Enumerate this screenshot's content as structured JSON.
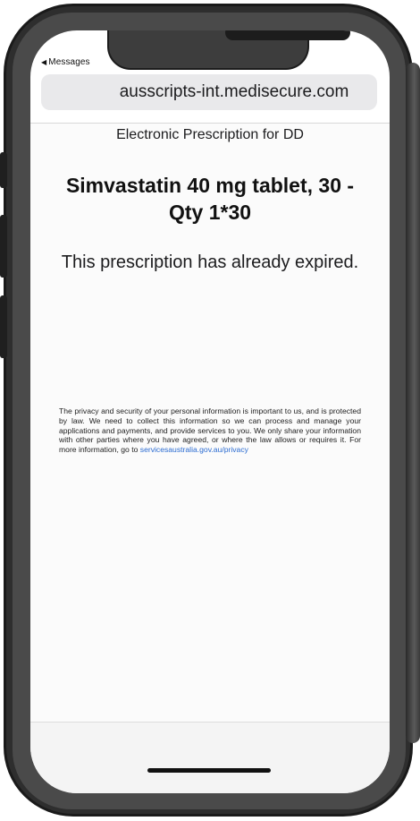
{
  "status_bar": {
    "back_label": "Messages"
  },
  "browser": {
    "url": "ausscripts-int.medisecure.com"
  },
  "page": {
    "subtitle": "Electronic Prescription for DD",
    "drug_title": "Simvastatin 40 mg tablet, 30 - Qty 1*30",
    "expired_message": "This prescription has already expired.",
    "privacy_text": "The privacy and security of your personal information is important to us, and is protected by law. We need to collect this information so we can process and manage your applications and payments, and provide services to you. We only share your information with other parties where you have agreed, or where the law allows or requires it. For more information, go to ",
    "privacy_link": "servicesaustralia.gov.au/privacy"
  },
  "colors": {
    "link": "#2a6bd1",
    "url_bar_bg": "#e9e9eb",
    "phone_frame": "#2e2e2e"
  }
}
